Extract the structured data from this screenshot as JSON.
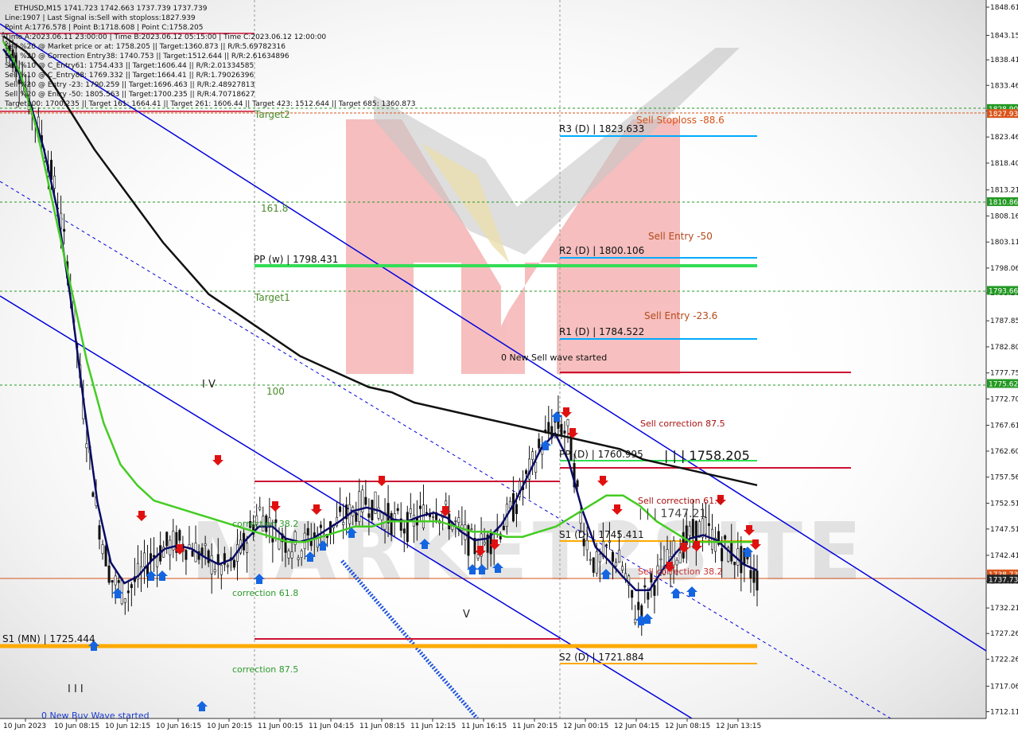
{
  "header": {
    "symbol_line": "ETHUSD,M15  1741.723 1742.663 1737.739 1737.739",
    "info_lines": [
      "Line:1907 | Last Signal is:Sell with stoploss:1827.939",
      "Point A:1776.578 | Point B:1718.608 | Point C:1758.205",
      "Time A:2023.06.11 23:00:00 | Time B:2023.06.12 05:15:00 | Time C:2023.06.12 12:00:00",
      "Sell %20 @ Market price or at: 1758.205 || Target:1360.873 || R/R:5.69782316",
      "Sell %20 @ Correction Entry38: 1740.753 || Target:1512.644 || R/R:2.61634896",
      "Sell %10 @ C_Entry61: 1754.433 || Target:1606.44 || R/R:2.01334585",
      "Sell %10 @ C_Entry88: 1769.332 || Target:1664.41 || R/R:1.79026396",
      "Sell %20 @ Entry -23: 1790.259 || Target:1696.463 || R/R:2.48927813",
      "Sell %20 @ Entry -50: 1805.563 || Target:1700.235 || R/R:4.70718627",
      "Target100: 1700.235 || Target 161: 1664.41 || Target 261: 1606.44 || Target 423: 1512.644 || Target 685: 1360.873"
    ]
  },
  "colors": {
    "background": "#ffffff",
    "bull_arrow": "#1565e0",
    "bear_arrow": "#e01010",
    "pivot_blue": "#00aaff",
    "green_pp": "#33dd55",
    "crimson": "#cc1133",
    "orange": "#ffaa00",
    "channel": "#0000dd",
    "ma_black": "#111111",
    "ma_navy": "#0a0a66",
    "ma_green": "#44cc22",
    "dotted_green": "#229922",
    "watermark_red": "#f08080"
  },
  "price_axis": {
    "labels": [
      "1848.61",
      "1843.15",
      "1838.41",
      "1833.46",
      "1828.50",
      "1823.46",
      "1818.40",
      "1813.21",
      "1808.16",
      "1803.11",
      "1798.06",
      "1793.26",
      "1787.85",
      "1782.80",
      "1777.75",
      "1772.70",
      "1767.61",
      "1762.60",
      "1757.56",
      "1752.51",
      "1747.51",
      "1742.41",
      "1737.38",
      "1732.21",
      "1727.26",
      "1722.26",
      "1717.06",
      "1712.11"
    ],
    "badges": [
      {
        "text": "1828.90",
        "color": "#229922"
      },
      {
        "text": "1827.93",
        "color": "#d9541a"
      },
      {
        "text": "1810.86",
        "color": "#229922"
      },
      {
        "text": "1793.66",
        "color": "#229922"
      },
      {
        "text": "1775.62",
        "color": "#229922"
      },
      {
        "text": "1738.73",
        "color": "#d9541a"
      },
      {
        "text": "1737.73",
        "color": "#222222"
      }
    ]
  },
  "time_axis": {
    "labels": [
      "10 Jun 2023",
      "10 Jun 08:15",
      "10 Jun 12:15",
      "10 Jun 16:15",
      "10 Jun 20:15",
      "11 Jun 00:15",
      "11 Jun 04:15",
      "11 Jun 08:15",
      "11 Jun 12:15",
      "11 Jun 16:15",
      "11 Jun 20:15",
      "12 Jun 00:15",
      "12 Jun 04:15",
      "12 Jun 08:15",
      "12 Jun 13:15"
    ]
  },
  "levels": {
    "r3": "R3 (D) | 1823.633",
    "r2": "R2 (D) | 1800.106",
    "r1": "R1 (D) | 1784.522",
    "pp_d": "PP (D) | 1760.995",
    "s1_d": "S1 (D) | 1745.411",
    "s2_d": "S2 (D) | 1721.884",
    "pp_w": "PP (w) | 1798.431",
    "s1_mn": "S1 (MN) | 1725.444",
    "point_c": "| | | 1758.205",
    "mid": "| | | 1747.21"
  },
  "annotations": {
    "sell_stoploss": "Sell Stoploss -88.6",
    "sell_entry_50": "Sell Entry -50",
    "sell_entry_23": "Sell Entry -23.6",
    "new_sell_wave": "0 New Sell wave started",
    "sell_corr_875": "Sell correction 87.5",
    "sell_corr_618": "Sell correction 61.8",
    "sell_corr_382": "Sell correction 38.2",
    "target2": "Target2",
    "target1": "Target1",
    "fib_1618": "161.8",
    "fib_100": "100",
    "corr_382": "correction 38.2",
    "corr_618": "correction 61.8",
    "corr_875": "correction 87.5",
    "new_buy_wave": "0 New Buy Wave started",
    "wave_v1": "V",
    "wave_v2": "V",
    "wave_i": "I",
    "wave_iii": "I I I"
  },
  "watermark": {
    "text": "MARKET2SITE"
  },
  "chart_data": {
    "type": "line",
    "title": "ETHUSD,M15",
    "ylim": [
      1710.8,
      1850.0
    ],
    "series": [
      {
        "values": [
          1843,
          1838,
          1830,
          1822,
          1812,
          1795,
          1770,
          1750,
          1738,
          1735,
          1738,
          1742,
          1744,
          1745,
          1744,
          1742,
          1740,
          1740,
          1745,
          1751,
          1748,
          1745,
          1744,
          1746,
          1747,
          1749,
          1751,
          1753,
          1751,
          1749,
          1748,
          1750,
          1752,
          1750,
          1747,
          1744,
          1745,
          1748,
          1752,
          1758,
          1764,
          1768,
          1766,
          1748,
          1740,
          1744,
          1740,
          1731,
          1736,
          1740,
          1743,
          1746,
          1748,
          1745,
          1743,
          1741,
          1738
        ]
      },
      {
        "values": [
          1842,
          1836,
          1825,
          1810,
          1795,
          1780,
          1768,
          1760,
          1756,
          1753,
          1752,
          1751,
          1750,
          1749,
          1748,
          1747,
          1746,
          1745,
          1745,
          1746,
          1747,
          1748,
          1748,
          1749,
          1749,
          1749,
          1749,
          1748,
          1747,
          1747,
          1746,
          1746,
          1747,
          1748,
          1750,
          1752,
          1754,
          1754,
          1752,
          1749,
          1747,
          1745,
          1745,
          1745,
          1745,
          1745
        ]
      },
      {
        "values": [
          1843,
          1840,
          1835,
          1828,
          1821,
          1815,
          1809,
          1803,
          1798,
          1793,
          1790,
          1787,
          1784,
          1781,
          1779,
          1777,
          1775,
          1774,
          1772,
          1771,
          1770,
          1769,
          1768,
          1767,
          1766,
          1765,
          1764,
          1763,
          1761,
          1760,
          1759,
          1758,
          1757,
          1756
        ]
      }
    ]
  }
}
